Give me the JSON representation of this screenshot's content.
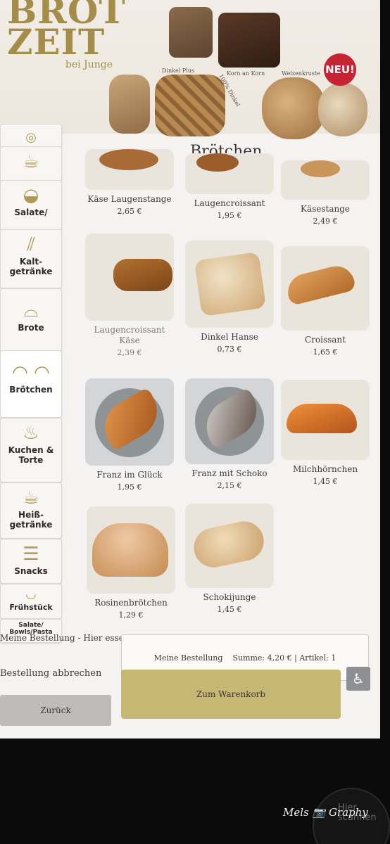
{
  "banner": {
    "brand_line1": "BROT",
    "brand_line2": "ZEIT",
    "brand_sub": "bei Junge",
    "bread_labels": [
      "Dinkel Plus",
      "Korn an Korn",
      "100% Dinkel",
      "Weizenkruste"
    ],
    "badge": "NEU!"
  },
  "section_title": "Brötchen",
  "categories": [
    {
      "label": "",
      "icon": "food-icon"
    },
    {
      "label": "",
      "icon": "breakfast-icon"
    },
    {
      "label": "Salate/",
      "icon": "salad-bowl-icon"
    },
    {
      "label": "Kalt-getränke",
      "icon": "bottle-icon"
    },
    {
      "label": "Brote",
      "icon": "bread-loaf-icon"
    },
    {
      "label": "Brötchen",
      "icon": "bread-roll-icon"
    },
    {
      "label": "Kuchen & Torte",
      "icon": "muffin-icon"
    },
    {
      "label": "Heiß-getränke",
      "icon": "coffee-cup-icon"
    },
    {
      "label": "Snacks",
      "icon": "sandwich-icon"
    },
    {
      "label": "Frühstück",
      "icon": "breakfast-icon"
    },
    {
      "label": "Salate/ Bowls/Pasta",
      "icon": "bowl-icon"
    }
  ],
  "products": [
    {
      "name": "Käse Laugenstange",
      "price": "2,65 €"
    },
    {
      "name": "Laugencroissant",
      "price": "1,95 €"
    },
    {
      "name": "Käsestange",
      "price": "2,49 €"
    },
    {
      "name": "Laugencroissant Käse",
      "price": "2,39 €"
    },
    {
      "name": "Dinkel Hanse",
      "price": "0,73 €"
    },
    {
      "name": "Croissant",
      "price": "1,65 €"
    },
    {
      "name": "Franz im Glück",
      "price": "1,95 €"
    },
    {
      "name": "Franz mit Schoko",
      "price": "2,15 €"
    },
    {
      "name": "Milchhörnchen",
      "price": "1,45 €"
    },
    {
      "name": "Rosinenbrötchen",
      "price": "1,29 €"
    },
    {
      "name": "Schokijunge",
      "price": "1,45 €"
    }
  ],
  "order": {
    "title": "Meine Bestellung - Hier essen",
    "cancel": "Bestellung abbrechen",
    "summary_label": "Meine Bestellung",
    "summary_value": "Summe: 4,20 € | Artikel: 1",
    "cart_button": "Zum Warenkorb",
    "back_button": "Zurück"
  },
  "photo": {
    "watermark": "Mels 📷 Graphy",
    "scan_text": "Hier scannen"
  }
}
